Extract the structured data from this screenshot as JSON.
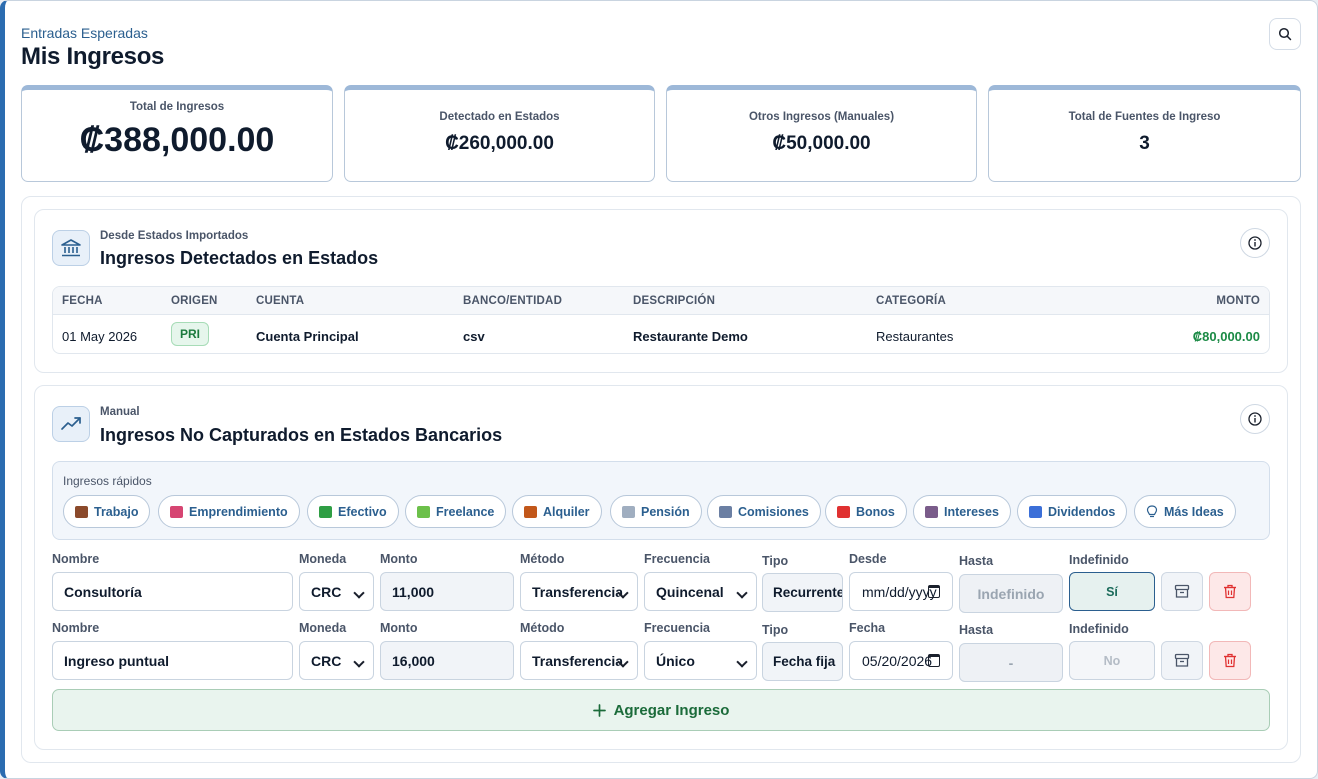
{
  "header": {
    "subtitle": "Entradas Esperadas",
    "title": "Mis Ingresos",
    "search_icon": "search-icon"
  },
  "stats": [
    {
      "label": "Total de Ingresos",
      "value": "₡388,000.00"
    },
    {
      "label": "Detectado en Estados",
      "value": "₡260,000.00"
    },
    {
      "label": "Otros Ingresos (Manuales)",
      "value": "₡50,000.00"
    },
    {
      "label": "Total de Fuentes de Ingreso",
      "value": "3"
    }
  ],
  "detected": {
    "kicker": "Desde Estados Importados",
    "title": "Ingresos Detectados en Estados",
    "icon": "bank-icon",
    "columns": {
      "fecha": "FECHA",
      "origen": "ORIGEN",
      "cuenta": "CUENTA",
      "banco": "BANCO/ENTIDAD",
      "descripcion": "DESCRIPCIÓN",
      "categoria": "CATEGORÍA",
      "monto": "MONTO"
    },
    "rows": [
      {
        "fecha": "01 May 2026",
        "origen": "PRI",
        "cuenta": "Cuenta Principal",
        "banco": "csv",
        "descripcion": "Restaurante Demo",
        "categoria": "Restaurantes",
        "monto": "₡80,000.00"
      }
    ]
  },
  "manual": {
    "kicker": "Manual",
    "title": "Ingresos No Capturados en Estados Bancarios",
    "icon": "trending-up-icon",
    "quick_label": "Ingresos rápidos",
    "quick": [
      {
        "label": "Trabajo",
        "icon": "briefcase-icon",
        "color": "#8b4a2b"
      },
      {
        "label": "Emprendimiento",
        "icon": "rocket-icon",
        "color": "#d64572"
      },
      {
        "label": "Efectivo",
        "icon": "money-icon",
        "color": "#2f9e44"
      },
      {
        "label": "Freelance",
        "icon": "puzzle-icon",
        "color": "#6cc04a"
      },
      {
        "label": "Alquiler",
        "icon": "house-icon",
        "color": "#c2571a"
      },
      {
        "label": "Pensión",
        "icon": "receipt-icon",
        "color": "#a0aec0"
      },
      {
        "label": "Comisiones",
        "icon": "chart-icon",
        "color": "#6b7fa3"
      },
      {
        "label": "Bonos",
        "icon": "gift-icon",
        "color": "#e03131"
      },
      {
        "label": "Intereses",
        "icon": "bank-icon",
        "color": "#7a5c8a"
      },
      {
        "label": "Dividendos",
        "icon": "bar-chart-icon",
        "color": "#3b6fd8"
      },
      {
        "label": "Más Ideas",
        "icon": "lightbulb-icon",
        "color": "#2b5f8f"
      }
    ],
    "field_labels": {
      "nombre": "Nombre",
      "moneda": "Moneda",
      "monto": "Monto",
      "metodo": "Método",
      "frecuencia": "Frecuencia",
      "tipo": "Tipo",
      "hasta": "Hasta",
      "indefinido": "Indefinido"
    },
    "entries": [
      {
        "nombre": "Consultoría",
        "moneda": "CRC",
        "monto": "11,000",
        "metodo": "Transferencia",
        "frecuencia": "Quincenal",
        "tipo": "Recurrente",
        "date_label": "Desde",
        "date_value": "mm/dd/yyyy",
        "hasta": "Indefinido",
        "indefinido": "Sí"
      },
      {
        "nombre": "Ingreso puntual",
        "moneda": "CRC",
        "monto": "16,000",
        "metodo": "Transferencia",
        "frecuencia": "Único",
        "tipo": "Fecha fija",
        "date_label": "Fecha",
        "date_value": "05/20/2026",
        "hasta": "-",
        "indefinido": "No"
      }
    ],
    "add_label": "Agregar Ingreso"
  },
  "colors": {
    "accent": "#2b6cb0",
    "positive": "#1b7a3d",
    "danger": "#e03131"
  }
}
